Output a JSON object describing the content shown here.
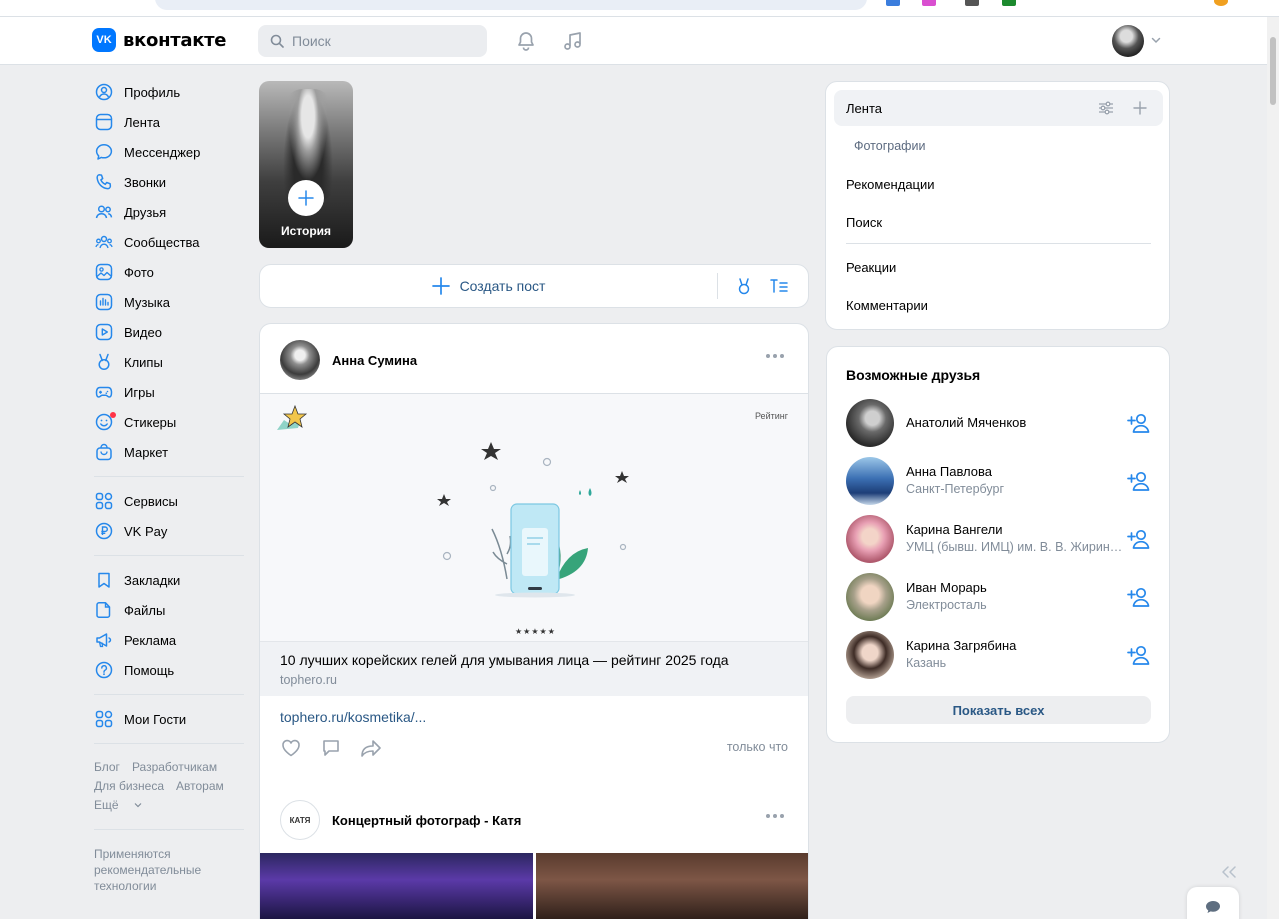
{
  "header": {
    "logo_badge": "VK",
    "logo_text": "вконтакте",
    "search_placeholder": "Поиск"
  },
  "leftnav": {
    "main": [
      {
        "label": "Профиль",
        "icon": "profile-icon"
      },
      {
        "label": "Лента",
        "icon": "feed-icon"
      },
      {
        "label": "Мессенджер",
        "icon": "messenger-icon"
      },
      {
        "label": "Звонки",
        "icon": "phone-icon"
      },
      {
        "label": "Друзья",
        "icon": "friends-icon"
      },
      {
        "label": "Сообщества",
        "icon": "communities-icon"
      },
      {
        "label": "Фото",
        "icon": "photo-icon"
      },
      {
        "label": "Музыка",
        "icon": "music-icon"
      },
      {
        "label": "Видео",
        "icon": "video-icon"
      },
      {
        "label": "Клипы",
        "icon": "clips-icon"
      },
      {
        "label": "Игры",
        "icon": "games-icon"
      },
      {
        "label": "Стикеры",
        "icon": "stickers-icon"
      },
      {
        "label": "Маркет",
        "icon": "market-icon"
      }
    ],
    "services": [
      {
        "label": "Сервисы",
        "icon": "services-icon"
      },
      {
        "label": "VK Pay",
        "icon": "vkpay-icon"
      }
    ],
    "extra": [
      {
        "label": "Закладки",
        "icon": "bookmark-icon"
      },
      {
        "label": "Файлы",
        "icon": "files-icon"
      },
      {
        "label": "Реклама",
        "icon": "ads-icon"
      },
      {
        "label": "Помощь",
        "icon": "help-icon"
      }
    ],
    "guests": {
      "label": "Мои Гости",
      "icon": "apps-icon"
    },
    "footer": {
      "blog": "Блог",
      "developers": "Разработчикам",
      "business": "Для бизнеса",
      "authors": "Авторам",
      "more": "Ещё"
    },
    "note": "Применяются рекомендательные технологии"
  },
  "story": {
    "label": "История"
  },
  "create_post": {
    "label": "Создать пост"
  },
  "post": {
    "author": "Анна Сумина",
    "snippet_tag": "Рейтинг",
    "snippet_stars": "★★★★★",
    "snippet_title": "10 лучших корейских гелей для умывания лица — рейтинг 2025 года",
    "snippet_domain": "tophero.ru",
    "link": "tophero.ru/kosmetika/...",
    "time": "только что"
  },
  "post2": {
    "avatar_text": "КАТЯ",
    "author": "Концертный фотограф - Катя"
  },
  "feed_menu": {
    "items": {
      "feed": "Лента",
      "photos": "Фотографии",
      "recommendations": "Рекомендации",
      "search": "Поиск",
      "reactions": "Реакции",
      "comments": "Комментарии"
    }
  },
  "friends": {
    "title": "Возможные друзья",
    "list": [
      {
        "name": "Анатолий Мяченков",
        "sub": ""
      },
      {
        "name": "Анна Павлова",
        "sub": "Санкт-Петербург"
      },
      {
        "name": "Карина Вангели",
        "sub": "УМЦ (бывш. ИМЦ) им. В. В. Жириновского"
      },
      {
        "name": "Иван Морарь",
        "sub": "Электросталь"
      },
      {
        "name": "Карина Загрябина",
        "sub": "Казань"
      }
    ],
    "show_all": "Показать всех"
  },
  "colors": {
    "accent": "#0077ff",
    "link": "#2a5885",
    "background": "#edeef0",
    "icon": "#2688eb",
    "secondary_text": "#818c99"
  }
}
